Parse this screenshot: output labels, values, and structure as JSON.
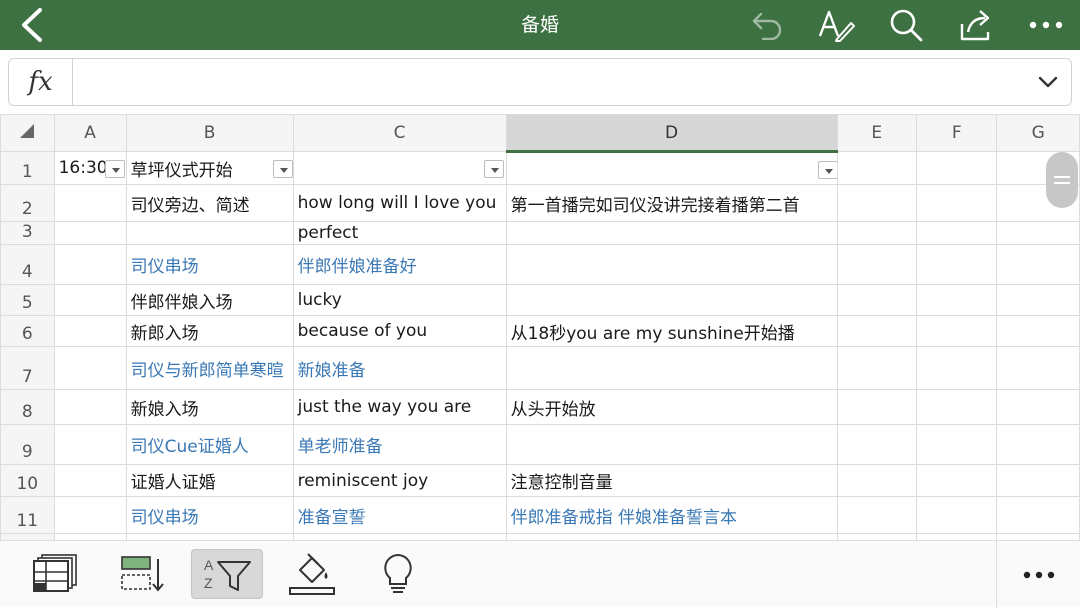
{
  "app": {
    "title": "备婚"
  },
  "toolbar": {
    "back": "back-icon",
    "undo": "undo-icon",
    "edit_text": "text-edit-icon",
    "search": "search-icon",
    "share": "share-icon",
    "more": "more-icon"
  },
  "formula_bar": {
    "label": "fx",
    "value": ""
  },
  "sheet": {
    "columns": [
      "A",
      "B",
      "C",
      "D",
      "E",
      "F",
      "G"
    ],
    "selected_column": "D",
    "rows": [
      {
        "num": "1",
        "a": "16:30",
        "b": "草坪仪式开始",
        "c": "",
        "d": ""
      },
      {
        "num": "2",
        "a": "",
        "b": "司仪旁边、简述",
        "c": "how long will I love you",
        "d": "第一首播完如司仪没讲完接着播第二首"
      },
      {
        "num": "3",
        "a": "",
        "b": "",
        "c": "perfect",
        "d": ""
      },
      {
        "num": "4",
        "a": "",
        "b": "司仪串场",
        "c": "伴郎伴娘准备好",
        "d": ""
      },
      {
        "num": "5",
        "a": "",
        "b": "伴郎伴娘入场",
        "c": "lucky",
        "d": ""
      },
      {
        "num": "6",
        "a": "",
        "b": "新郎入场",
        "c": "because of you",
        "d": "从18秒you are my sunshine开始播"
      },
      {
        "num": "7",
        "a": "",
        "b": "司仪与新郎简单寒暄",
        "c": "新娘准备",
        "d": ""
      },
      {
        "num": "8",
        "a": "",
        "b": "新娘入场",
        "c": "just the way you are",
        "d": "从头开始放"
      },
      {
        "num": "9",
        "a": "",
        "b": "司仪Cue证婚人",
        "c": "单老师准备",
        "d": ""
      },
      {
        "num": "10",
        "a": "",
        "b": "证婚人证婚",
        "c": "reminiscent joy",
        "d": "注意控制音量"
      },
      {
        "num": "11",
        "a": "",
        "b": "司仪串场",
        "c": "准备宣誓",
        "d": "伴郎准备戒指 伴娘准备誓言本"
      }
    ]
  },
  "bottom_toolbar": {
    "items": [
      "freeze-panes-icon",
      "insert-row-icon",
      "sort-filter-icon",
      "fill-color-icon",
      "ideas-icon"
    ],
    "active": "sort-filter-icon",
    "more": "more-icon"
  },
  "colors": {
    "header_green": "#3d7142",
    "blue_text": "#3a78b5"
  }
}
